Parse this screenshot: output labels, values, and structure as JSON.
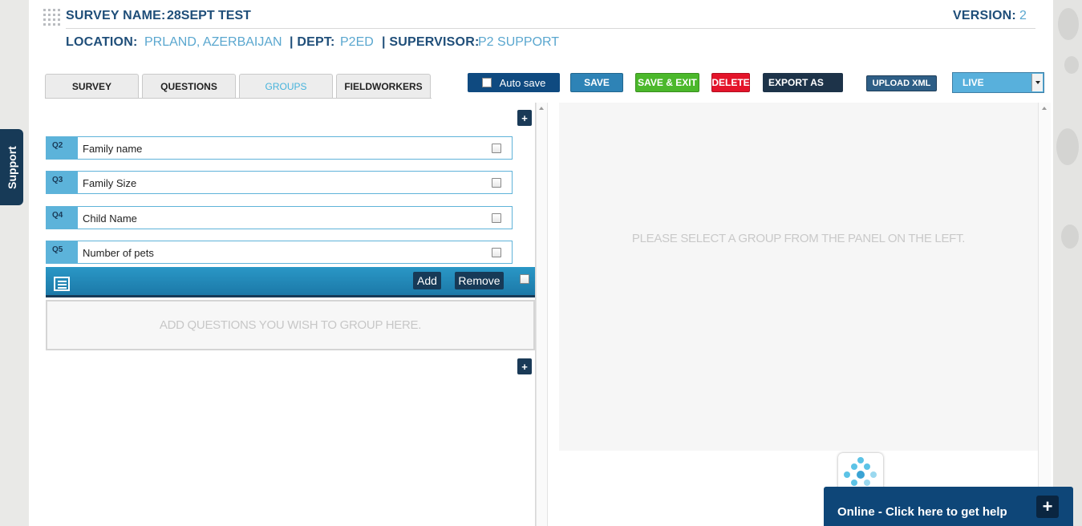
{
  "header": {
    "survey_name_label": "SURVEY NAME:",
    "survey_name_value": "28SEPT TEST",
    "version_label": "VERSION:",
    "version_value": "2",
    "location_label": "LOCATION:",
    "location_value": "PRLAND, AZERBAIJAN",
    "dept_label": "| DEPT:",
    "dept_value": "P2ED",
    "supervisor_label": "| SUPERVISOR:",
    "supervisor_value": "P2 SUPPORT"
  },
  "tabs": [
    {
      "label": "SURVEY",
      "active": false
    },
    {
      "label": "QUESTIONS",
      "active": false
    },
    {
      "label": "GROUPS",
      "active": true
    },
    {
      "label": "FIELDWORKERS",
      "active": false
    }
  ],
  "toolbar": {
    "autosave_label": "Auto save",
    "save_label": "SAVE",
    "save_exit_label": "SAVE & EXIT",
    "delete_label": "DELETE",
    "export_label": "EXPORT AS",
    "upload_label": "UPLOAD XML",
    "status_selected": "LIVE"
  },
  "support_label": "Support",
  "questions": [
    {
      "num": "Q2",
      "text": "Family name"
    },
    {
      "num": "Q3",
      "text": "Family Size"
    },
    {
      "num": "Q4",
      "text": "Child Name"
    },
    {
      "num": "Q5",
      "text": "Number of pets"
    }
  ],
  "group": {
    "add_label": "Add",
    "remove_label": "Remove",
    "dropzone_text": "ADD QUESTIONS YOU WISH TO GROUP HERE."
  },
  "plus_label": "+",
  "right_panel_message": "PLEASE SELECT A GROUP FROM THE PANEL ON THE LEFT.",
  "help": {
    "text": "Online - Click here to get help",
    "plus": "+"
  },
  "colors": {
    "primary_dark": "#1f4e79",
    "accent_blue": "#5cb3da",
    "save_green": "#4bb82b",
    "delete_red": "#e4142a",
    "help_bar": "#0e4678"
  }
}
